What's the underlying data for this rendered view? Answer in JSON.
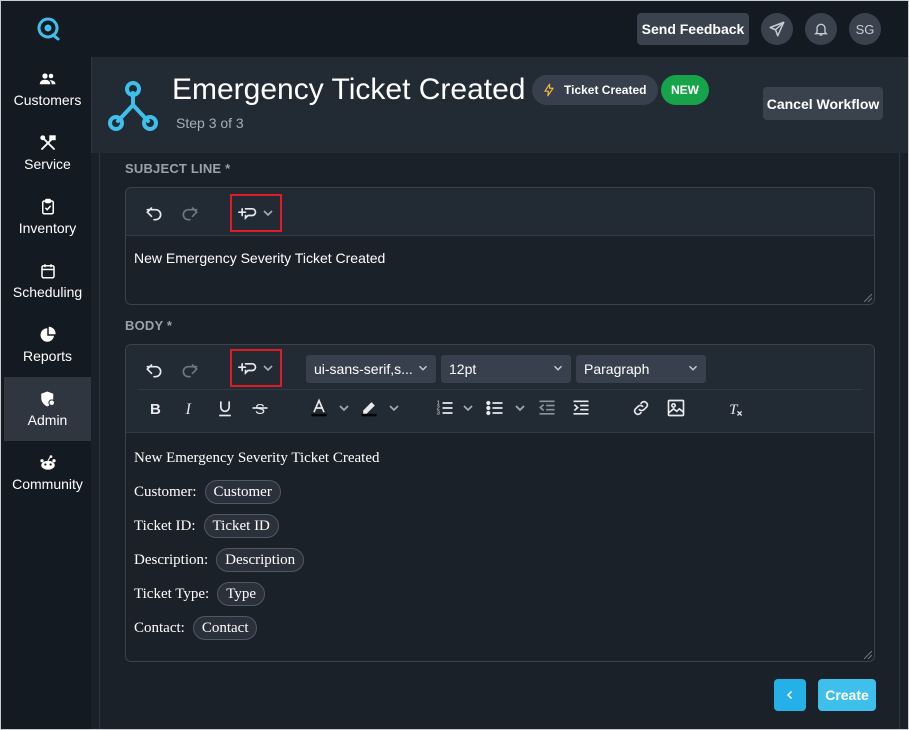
{
  "topbar": {
    "feedback_label": "Send Feedback",
    "avatar_initials": "SG"
  },
  "sidebar": {
    "items": [
      {
        "label": "Customers",
        "icon": "users-icon"
      },
      {
        "label": "Service",
        "icon": "tools-icon"
      },
      {
        "label": "Inventory",
        "icon": "clipboard-icon"
      },
      {
        "label": "Scheduling",
        "icon": "calendar-icon"
      },
      {
        "label": "Reports",
        "icon": "pie-chart-icon"
      },
      {
        "label": "Admin",
        "icon": "admin-shield-icon",
        "active": true
      },
      {
        "label": "Community",
        "icon": "community-icon"
      }
    ]
  },
  "header": {
    "title": "Emergency Ticket Created",
    "step": "Step 3 of 3",
    "trigger_badge": "Ticket Created",
    "new_badge": "NEW",
    "cancel_label": "Cancel Workflow"
  },
  "subject": {
    "label": "SUBJECT LINE *",
    "value": "New Emergency Severity Ticket Created"
  },
  "body": {
    "label": "BODY *",
    "font_family": "ui-sans-serif,s...",
    "font_size": "12pt",
    "block_format": "Paragraph",
    "heading": "New Emergency Severity Ticket Created",
    "fields": [
      {
        "label": "Customer:",
        "token": "Customer"
      },
      {
        "label": "Ticket ID:",
        "token": "Ticket ID"
      },
      {
        "label": "Description:",
        "token": "Description"
      },
      {
        "label": "Ticket Type:",
        "token": "Type"
      },
      {
        "label": "Contact:",
        "token": "Contact"
      }
    ]
  },
  "footer": {
    "create_label": "Create"
  },
  "colors": {
    "accent": "#3fbfec",
    "new_badge": "#16a34a",
    "highlight_box": "#e01b24"
  }
}
